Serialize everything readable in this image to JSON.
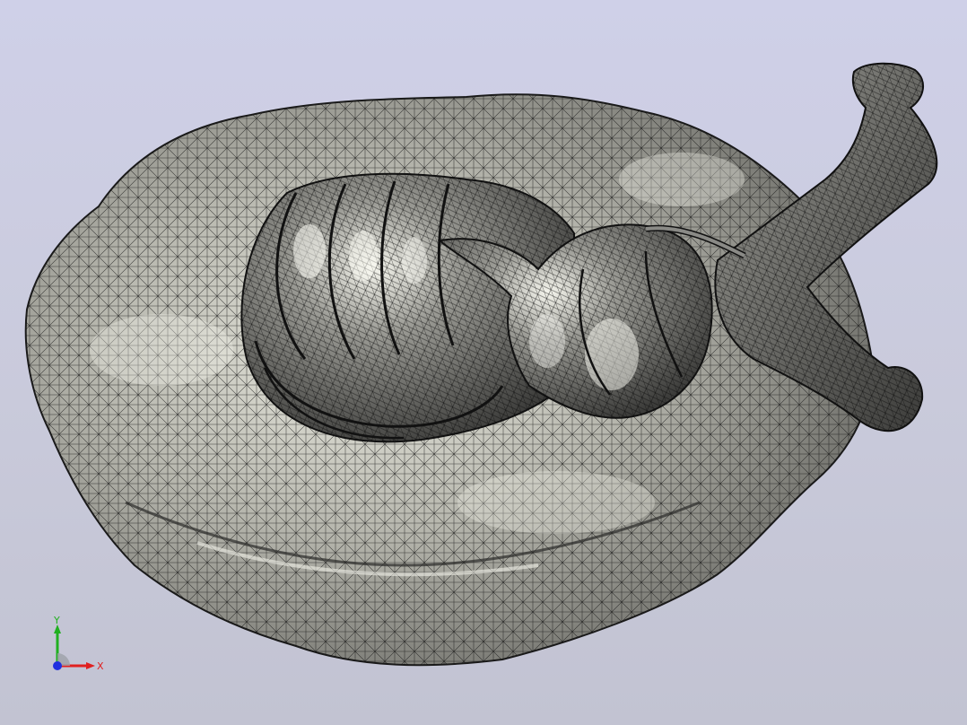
{
  "viewport": {
    "background_top": "#cfd0e8",
    "background_bottom": "#c2c3d2",
    "display_mode": "shaded-with-edges",
    "model": {
      "name": "",
      "surface_color": "#8a8a86",
      "highlight_color": "#f2f2ea",
      "edge_color": "#111111"
    }
  },
  "triad": {
    "x_label": "X",
    "y_label": "Y",
    "x_color": "#e02020",
    "y_color": "#20b020",
    "z_color": "#2030e0"
  }
}
